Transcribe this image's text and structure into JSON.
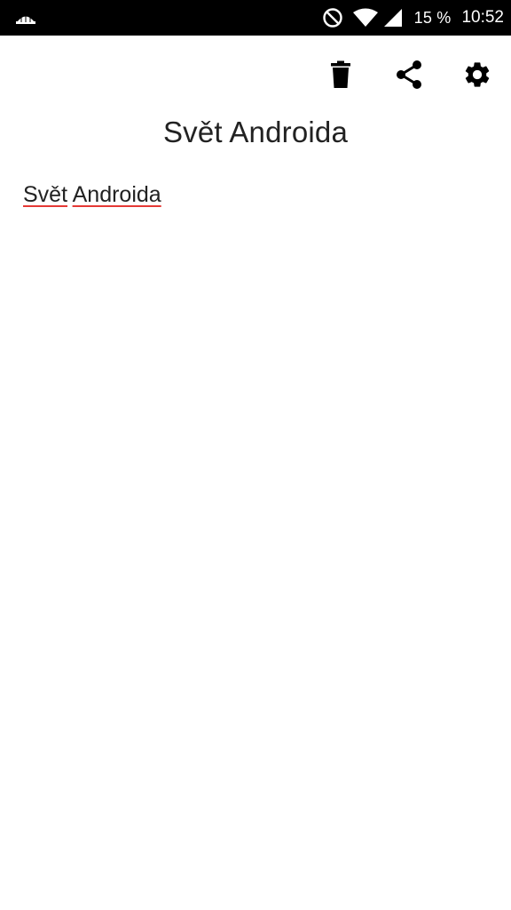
{
  "status_bar": {
    "battery": "15 %",
    "time": "10:52",
    "icons": [
      "notification-app-icon",
      "do-not-disturb-icon",
      "wifi-icon",
      "cell-signal-icon"
    ]
  },
  "toolbar": {
    "actions": [
      {
        "name": "delete",
        "icon": "trash-icon"
      },
      {
        "name": "share",
        "icon": "share-icon"
      },
      {
        "name": "settings",
        "icon": "gear-icon"
      }
    ]
  },
  "note": {
    "title": "Svět Androida",
    "body_words": [
      "Svět",
      "Androida"
    ]
  },
  "colors": {
    "status_bar_bg": "#000000",
    "background": "#ffffff",
    "text": "#222222",
    "spellcheck_underline": "#e53935"
  }
}
